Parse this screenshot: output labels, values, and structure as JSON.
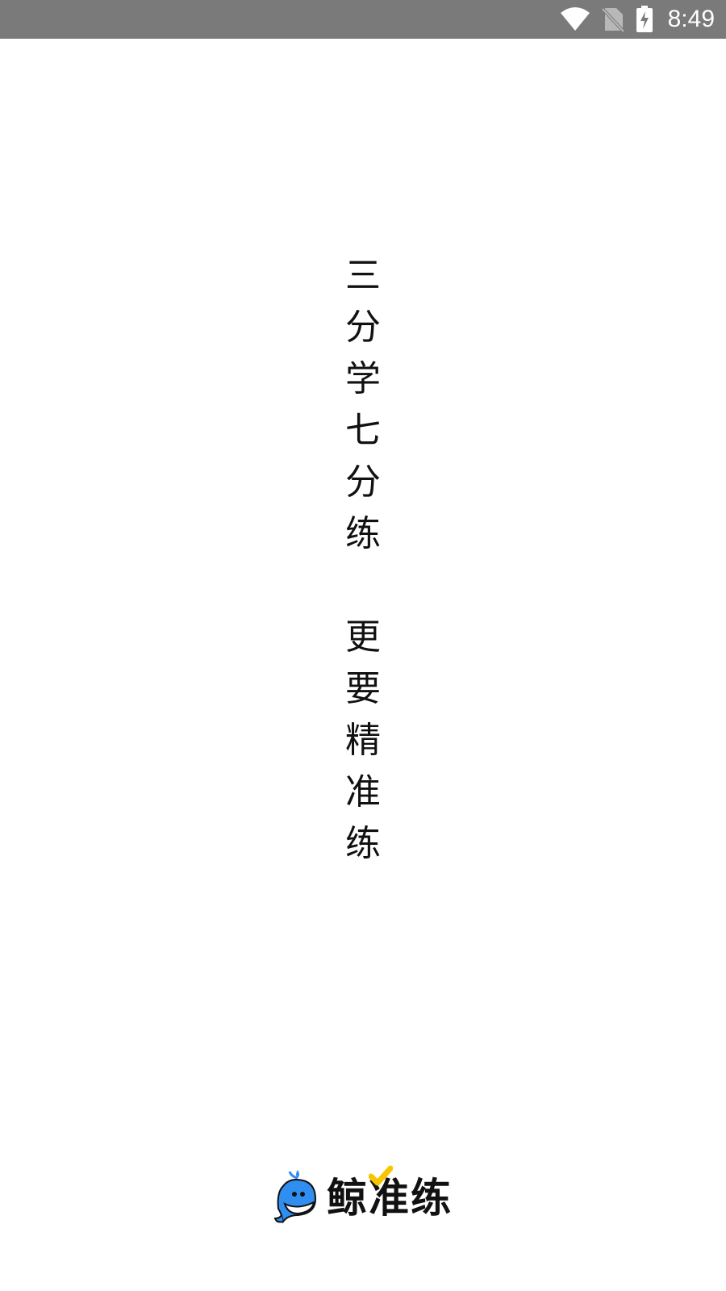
{
  "status_bar": {
    "time": "8:49",
    "icons": [
      "wifi-icon",
      "no-sim-icon",
      "battery-charging-icon"
    ]
  },
  "slogan": {
    "line1": [
      "三",
      "分",
      "学",
      "七",
      "分",
      "练"
    ],
    "line2": [
      "更",
      "要",
      "精",
      "准",
      "练"
    ]
  },
  "brand": {
    "name": "鲸准练",
    "logo_icon": "whale-mascot-icon",
    "accent_color": "#f7c600",
    "mascot_color": "#2f8ef0"
  }
}
